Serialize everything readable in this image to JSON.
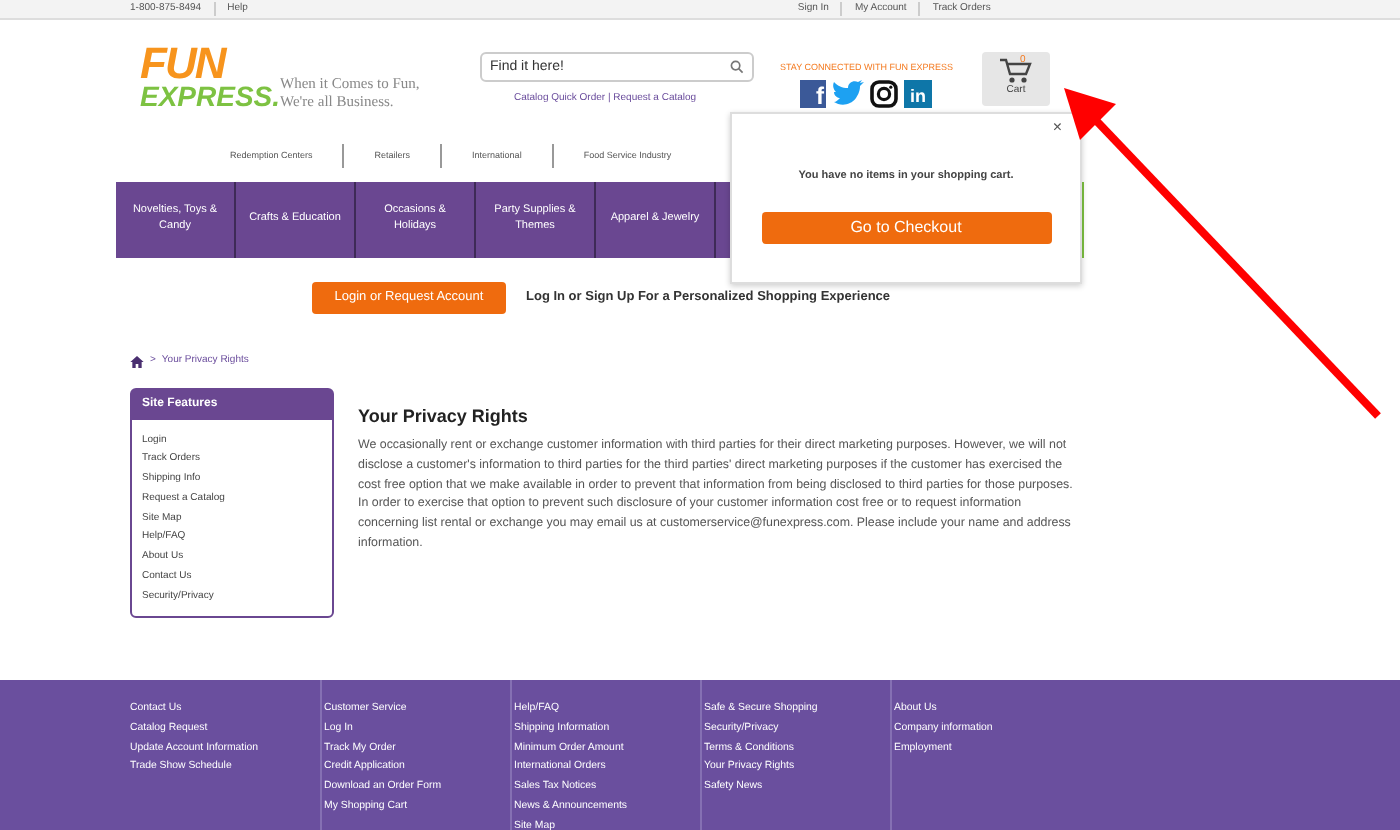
{
  "top_bar": {
    "phone": "1-800-875-8494",
    "left_links": [
      "Help"
    ],
    "right_links": [
      "Sign In",
      "My Account",
      "Track Orders"
    ]
  },
  "logo": {
    "top": "FUN",
    "bottom": "EXPRESS.",
    "tagline": [
      "When it Comes to Fun,",
      "We're all Business."
    ]
  },
  "search": {
    "placeholder": "Find it here!"
  },
  "search_links": {
    "separator": "|",
    "links": [
      "Catalog Quick Order",
      "Request a Catalog"
    ]
  },
  "social": {
    "heading": "STAY CONNECTED WITH FUN EXPRESS",
    "icons": [
      {
        "kind": "facebook",
        "glyph": "f"
      },
      {
        "kind": "twitter"
      },
      {
        "kind": "instagram"
      },
      {
        "kind": "linkedin",
        "glyph": "in"
      }
    ]
  },
  "cart": {
    "count": "0",
    "label": "Cart"
  },
  "secondary_nav": [
    "Redemption Centers",
    "Retailers",
    "International",
    "Food Service Industry"
  ],
  "main_nav": [
    "Novelties, Toys & Candy",
    "Crafts & Education",
    "Occasions & Holidays",
    "Party Supplies & Themes",
    "Apparel & Jewelry"
  ],
  "cart_popup": {
    "close": "×",
    "message": "You have no items in your shopping cart.",
    "button": "Go to Checkout"
  },
  "login": {
    "button": "Login or Request Account",
    "text": "Log In or Sign Up For a Personalized Shopping Experience"
  },
  "breadcrumb": {
    "sep": ">",
    "current": "Your Privacy Rights"
  },
  "sidebar": {
    "title": "Site Features",
    "items": [
      "Login",
      "Track Orders",
      "Shipping Info",
      "Request a Catalog",
      "Site Map",
      "Help/FAQ",
      "About Us",
      "Contact Us",
      "Security/Privacy"
    ]
  },
  "content": {
    "title": "Your Privacy Rights",
    "text": "We occasionally rent or exchange customer information with third parties for their direct marketing purposes. However, we will not disclose a customer's information to third parties for the third parties' direct marketing purposes if the customer has exercised the cost free option that we make available in order to prevent that information from being disclosed to third parties for those purposes. In order to exercise that option to prevent such disclosure of your customer information cost free or to request information concerning list rental or exchange you may email us at",
    "email": "customerservice@funexpress.com",
    "after": ". Please include your name and address information."
  },
  "footer": [
    {
      "heading": "Contact Us",
      "links": [
        "Catalog Request",
        "Update Account Information",
        "Trade Show Schedule"
      ]
    },
    {
      "heading": "Customer Service",
      "links": [
        "Log In",
        "Track My Order",
        "Credit Application",
        "Download an Order Form",
        "My Shopping Cart"
      ]
    },
    {
      "heading": "Help/FAQ",
      "links": [
        "Shipping Information",
        "Minimum Order Amount",
        "International Orders",
        "Sales Tax Notices",
        "News & Announcements",
        "Site Map"
      ]
    },
    {
      "heading": "Safe & Secure Shopping",
      "links": [
        "Security/Privacy",
        "Terms & Conditions",
        "Your Privacy Rights",
        "Safety News"
      ]
    },
    {
      "heading": "About Us",
      "links": [
        "Company information",
        "Employment"
      ]
    }
  ]
}
